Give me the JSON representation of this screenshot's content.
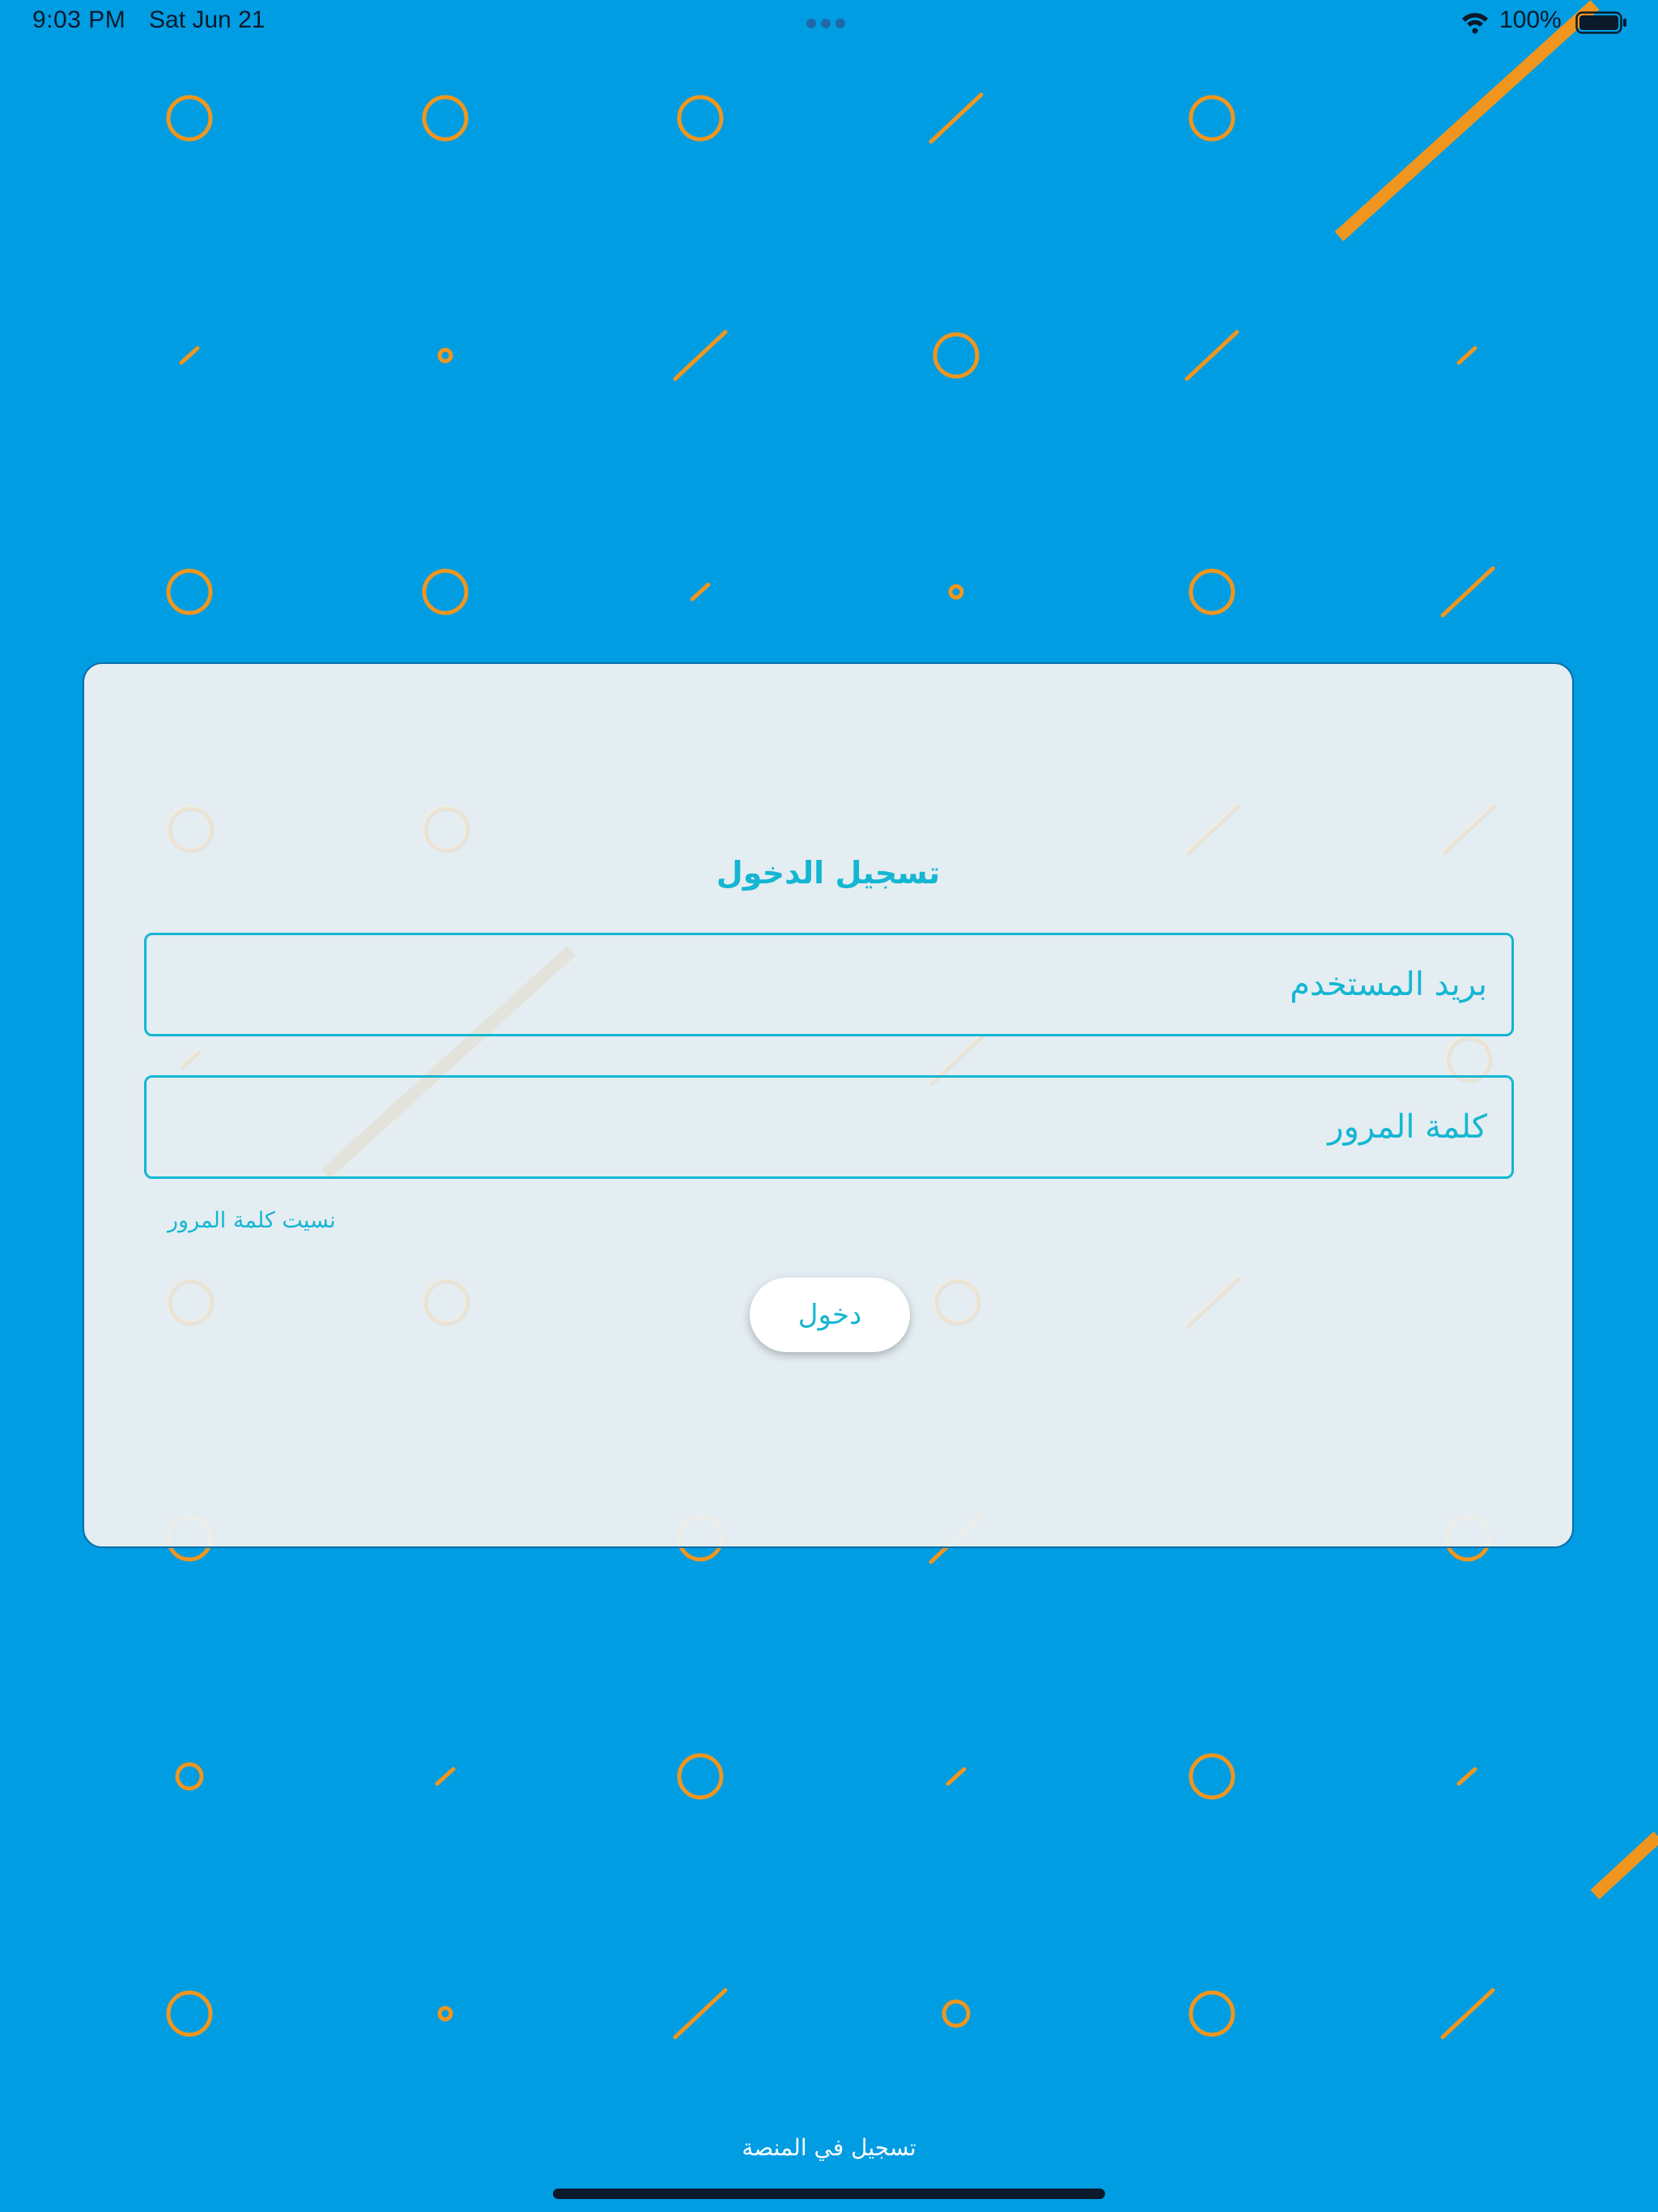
{
  "status_bar": {
    "time": "9:03 PM",
    "date": "Sat Jun 21",
    "battery": "100%",
    "icons": [
      "wifi-icon",
      "battery-icon",
      "multitask-dots-icon"
    ]
  },
  "login": {
    "title": "تسجيل الدخول",
    "email_placeholder": "بريد المستخدم",
    "email_value": "",
    "password_placeholder": "كلمة المرور",
    "password_value": "",
    "forgot_password": "نسيت كلمة المرور",
    "submit_label": "دخول"
  },
  "footer": {
    "register_label": "تسجيل في المنصة"
  },
  "colors": {
    "background": "#009de3",
    "pattern": "#f0961e",
    "accent": "#14b6d2",
    "card": "#ecf0f3"
  }
}
